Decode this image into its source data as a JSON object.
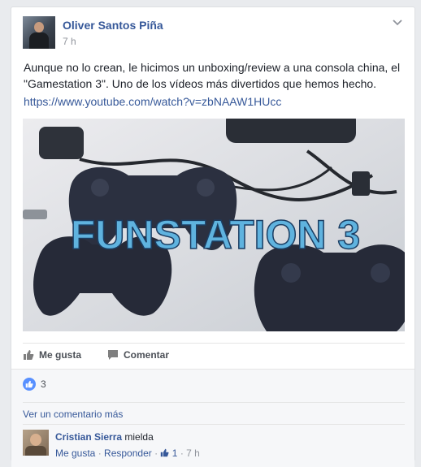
{
  "post": {
    "author": "Oliver Santos Piña",
    "time": "7 h",
    "text": "Aunque no lo crean, le hicimos un unboxing/review a una consola china, el \"Gamestation 3\". Uno de los vídeos más divertidos que hemos hecho.",
    "link": "https://www.youtube.com/watch?v=zbNAAW1HUcc",
    "media_title": "FUNSTATION 3"
  },
  "actions": {
    "like": "Me gusta",
    "comment": "Comentar"
  },
  "reactions": {
    "count": "3"
  },
  "comments": {
    "view_more": "Ver un comentario más",
    "items": [
      {
        "author": "Cristian Sierra",
        "text": "mielda",
        "like": "Me gusta",
        "separator": "·",
        "reply": "Responder",
        "likes": "1",
        "time": "7 h"
      }
    ]
  },
  "colors": {
    "link": "#365899",
    "like_blue": "#5890ff",
    "title_blue": "#5fb3df"
  }
}
